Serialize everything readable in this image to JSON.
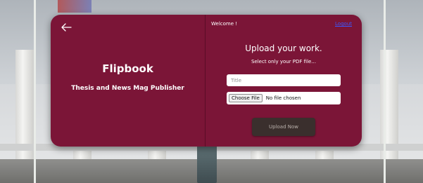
{
  "brand": {
    "title": "Flipbook",
    "subtitle": "Thesis and News Mag Publisher"
  },
  "header": {
    "welcome": "Welcome !",
    "logout": "Logout"
  },
  "upload": {
    "title": "Upload your work.",
    "subtitle": "Select only your PDF file...",
    "title_placeholder": "Title",
    "choose_file_label": "Choose File",
    "file_status": "No file chosen",
    "submit_label": "Upload Now"
  },
  "icons": {
    "back": "arrow-left-icon"
  },
  "colors": {
    "card": "#7b1537",
    "button": "#3a2f2d",
    "link": "#3a58ff"
  }
}
